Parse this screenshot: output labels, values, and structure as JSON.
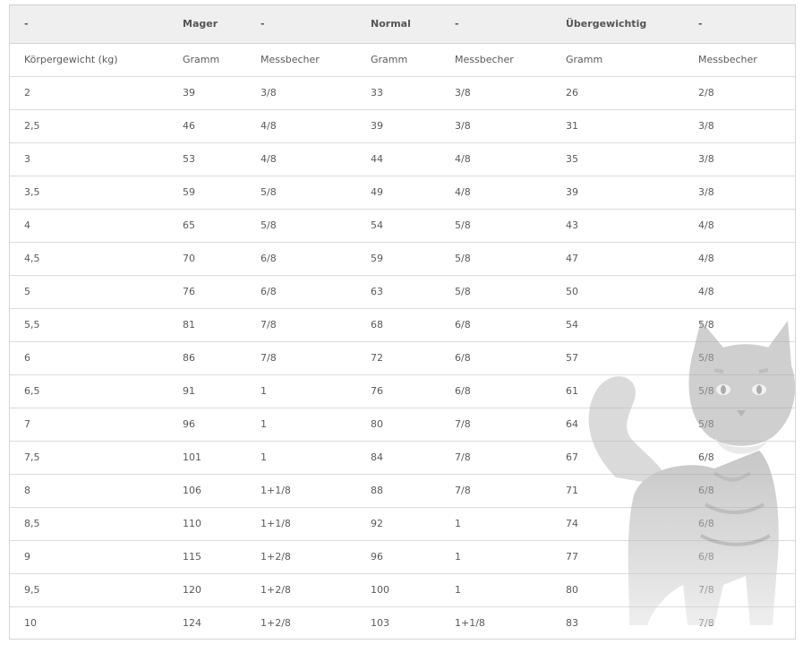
{
  "table": {
    "header": [
      "-",
      "Mager",
      "-",
      "Normal",
      "-",
      "Übergewichtig",
      "-"
    ],
    "subheader": [
      "Körpergewicht (kg)",
      "Gramm",
      "Messbecher",
      "Gramm",
      "Messbecher",
      "Gramm",
      "Messbecher"
    ],
    "rows": [
      [
        "2",
        "39",
        "3/8",
        "33",
        "3/8",
        "26",
        "2/8"
      ],
      [
        "2,5",
        "46",
        "4/8",
        "39",
        "3/8",
        "31",
        "3/8"
      ],
      [
        "3",
        "53",
        "4/8",
        "44",
        "4/8",
        "35",
        "3/8"
      ],
      [
        "3,5",
        "59",
        "5/8",
        "49",
        "4/8",
        "39",
        "3/8"
      ],
      [
        "4",
        "65",
        "5/8",
        "54",
        "5/8",
        "43",
        "4/8"
      ],
      [
        "4,5",
        "70",
        "6/8",
        "59",
        "5/8",
        "47",
        "4/8"
      ],
      [
        "5",
        "76",
        "6/8",
        "63",
        "5/8",
        "50",
        "4/8"
      ],
      [
        "5,5",
        "81",
        "7/8",
        "68",
        "6/8",
        "54",
        "5/8"
      ],
      [
        "6",
        "86",
        "7/8",
        "72",
        "6/8",
        "57",
        "5/8"
      ],
      [
        "6,5",
        "91",
        "1",
        "76",
        "6/8",
        "61",
        "5/8"
      ],
      [
        "7",
        "96",
        "1",
        "80",
        "7/8",
        "64",
        "5/8"
      ],
      [
        "7,5",
        "101",
        "1",
        "84",
        "7/8",
        "67",
        "6/8"
      ],
      [
        "8",
        "106",
        "1+1/8",
        "88",
        "7/8",
        "71",
        "6/8"
      ],
      [
        "8,5",
        "110",
        "1+1/8",
        "92",
        "1",
        "74",
        "6/8"
      ],
      [
        "9",
        "115",
        "1+2/8",
        "96",
        "1",
        "77",
        "6/8"
      ],
      [
        "9,5",
        "120",
        "1+2/8",
        "100",
        "1",
        "80",
        "7/8"
      ],
      [
        "10",
        "124",
        "1+2/8",
        "103",
        "1+1/8",
        "83",
        "7/8"
      ]
    ]
  },
  "decoration": {
    "image": "cat-illustration"
  }
}
